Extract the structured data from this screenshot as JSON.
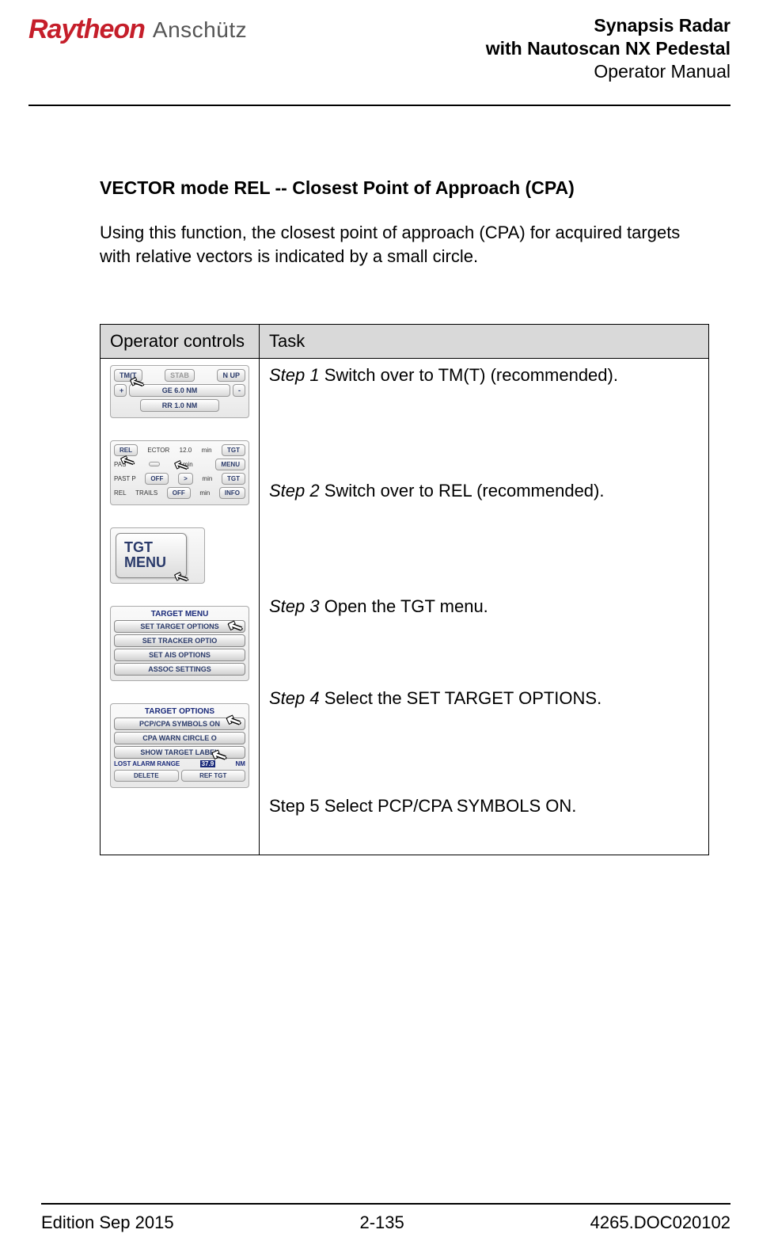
{
  "header": {
    "logo_brand": "Raytheon",
    "logo_sub": "Anschütz",
    "title_line1": "Synapsis Radar",
    "title_line2": "with Nautoscan NX Pedestal",
    "title_line3": "Operator Manual"
  },
  "section": {
    "heading": "VECTOR mode REL -- Closest Point of Approach (CPA)",
    "intro": "Using this function, the closest point of approach (CPA) for acquired targets with relative vectors is indicated by a small circle."
  },
  "table": {
    "col1": "Operator controls",
    "col2": "Task",
    "steps": [
      {
        "label": "Step 1",
        "text": " Switch over to TM(T) (recommended)."
      },
      {
        "label": "Step 2",
        "text": " Switch over to REL (recommended)."
      },
      {
        "label": "Step 3",
        "text": " Open the TGT menu."
      },
      {
        "label": "Step 4",
        "text": " Select the SET TARGET OPTIONS."
      },
      {
        "label": "Step 5",
        "text": " Select PCP/CPA SYMBOLS ON."
      }
    ]
  },
  "panels": {
    "p1": {
      "tmt": "TM(T",
      "stab": "STAB",
      "nup": "N UP",
      "plus": "+",
      "range": "GE 6.0 NM",
      "minus": "-",
      "rr": "RR 1.0 NM"
    },
    "p2": {
      "r1a": "REL",
      "r1b": "ECTOR",
      "r1c": "12.0",
      "r1d": "min",
      "r1e": "TGT",
      "r2a": "PAS",
      "r2b": "",
      "r2c": "min",
      "r2d": "MENU",
      "r3a": "PAST P",
      "r3b": "OFF",
      "r3c": ">",
      "r3d": "min",
      "r3e": "TGT",
      "r4a": "REL",
      "r4b": "TRAILS",
      "r4c": "OFF",
      "r4d": "min",
      "r4e": "INFO"
    },
    "p3": {
      "line1": "TGT",
      "line2": "MENU"
    },
    "p4": {
      "hdr": "TARGET MENU",
      "b1": "SET TARGET OPTIONS",
      "b2": "SET TRACKER OPTIO",
      "b3": "SET AIS OPTIONS",
      "b4": "ASSOC SETTINGS"
    },
    "p5": {
      "hdr": "TARGET OPTIONS",
      "b1": "PCP/CPA SYMBOLS ON",
      "b2": "CPA WARN CIRCLE O",
      "b3": "SHOW TARGET LABEL",
      "lost_l": "LOST ALARM RANGE",
      "lost_v": "37.9",
      "lost_u": "NM",
      "del": "DELETE",
      "ref": "REF TGT"
    }
  },
  "footer": {
    "left": "Edition Sep 2015",
    "center": "2-135",
    "right": "4265.DOC020102"
  }
}
